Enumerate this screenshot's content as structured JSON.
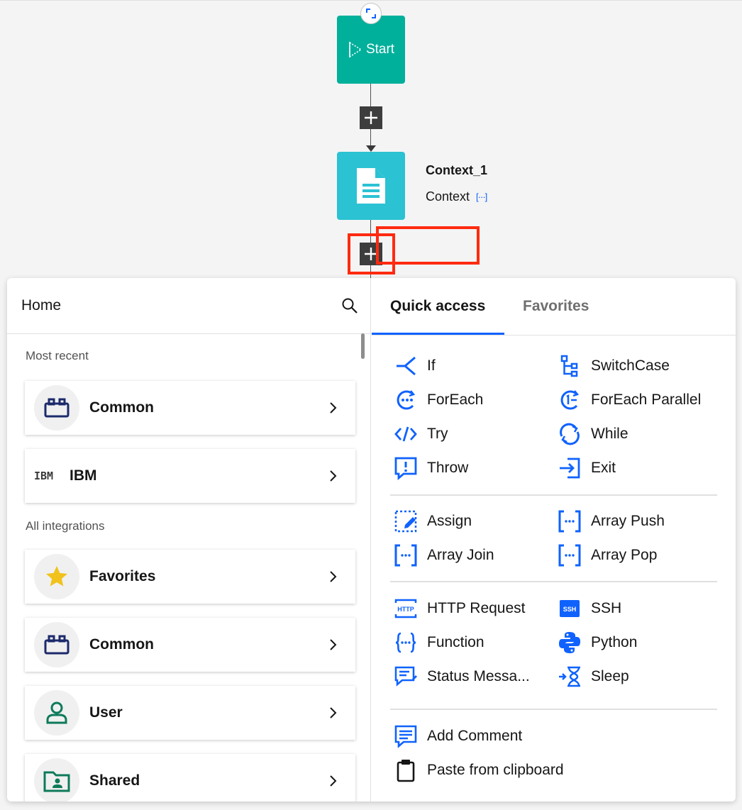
{
  "flow": {
    "start_label": "Start",
    "context_node": {
      "title": "Context_1",
      "type": "Context",
      "more": "[···]"
    }
  },
  "left_panel": {
    "title": "Home",
    "most_recent_label": "Most recent",
    "all_integrations_label": "All integrations",
    "recent": [
      {
        "name": "Common",
        "icon": "common-icon"
      },
      {
        "name": "IBM",
        "icon": "ibm-logo",
        "logo_text": "IBM"
      }
    ],
    "integrations": [
      {
        "name": "Favorites",
        "icon": "star-icon"
      },
      {
        "name": "Common",
        "icon": "common-icon"
      },
      {
        "name": "User",
        "icon": "user-icon"
      },
      {
        "name": "Shared",
        "icon": "shared-folder-icon"
      }
    ]
  },
  "right_panel": {
    "tabs": [
      {
        "label": "Quick access",
        "active": true
      },
      {
        "label": "Favorites",
        "active": false
      }
    ],
    "items": {
      "if": "If",
      "switchcase": "SwitchCase",
      "foreach": "ForEach",
      "foreach_parallel": "ForEach Parallel",
      "try": "Try",
      "while": "While",
      "throw": "Throw",
      "exit": "Exit",
      "assign": "Assign",
      "array_push": "Array Push",
      "array_join": "Array Join",
      "array_pop": "Array Pop",
      "http_request": "HTTP Request",
      "ssh": "SSH",
      "function": "Function",
      "python": "Python",
      "status_message": "Status Messa...",
      "sleep": "Sleep",
      "add_comment": "Add Comment",
      "paste": "Paste from clipboard"
    },
    "icon_text": {
      "http": "HTTP",
      "ssh": "SSH"
    }
  },
  "colors": {
    "accent": "#0f62fe",
    "start": "#00b09b",
    "context": "#2bc2d3",
    "highlight": "#ff2a10"
  }
}
